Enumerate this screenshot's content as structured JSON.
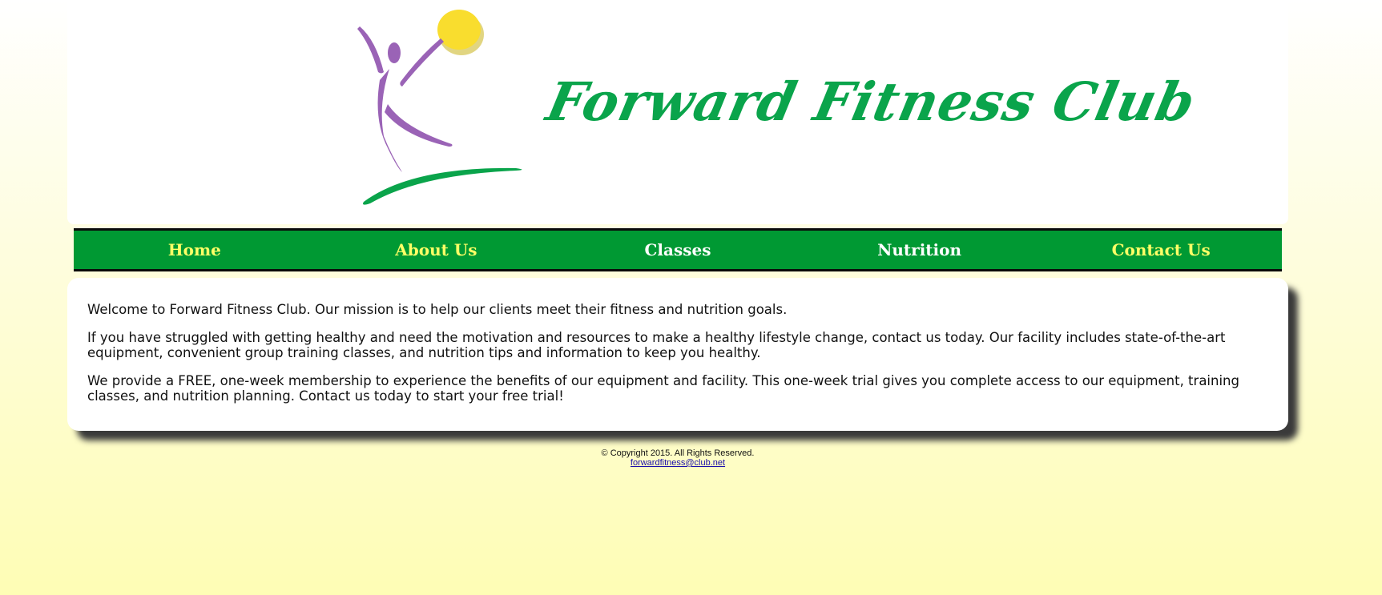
{
  "header": {
    "logo_text": "Forward Fitness Club",
    "colors": {
      "green": "#0aa44b",
      "purple": "#9a63b6",
      "sun": "#f9dd2e"
    }
  },
  "nav": {
    "items": [
      {
        "label": "Home"
      },
      {
        "label": "About Us"
      },
      {
        "label": "Classes"
      },
      {
        "label": "Nutrition"
      },
      {
        "label": "Contact Us"
      }
    ]
  },
  "main": {
    "paragraphs": [
      "Welcome to Forward Fitness Club. Our mission is to help our clients meet their fitness and nutrition goals.",
      "If you have struggled with getting healthy and need the motivation and resources to make a healthy lifestyle change, contact us today. Our facility includes state-of-the-art equipment, convenient group training classes, and nutrition tips and information to keep you healthy.",
      "We provide a FREE, one-week membership to experience the benefits of our equipment and facility. This one-week trial gives you complete access to our equipment, training classes, and nutrition planning. Contact us today to start your free trial!"
    ]
  },
  "footer": {
    "copyright": "© Copyright 2015. All Rights Reserved.",
    "email": "forwardfitness@club.net"
  }
}
